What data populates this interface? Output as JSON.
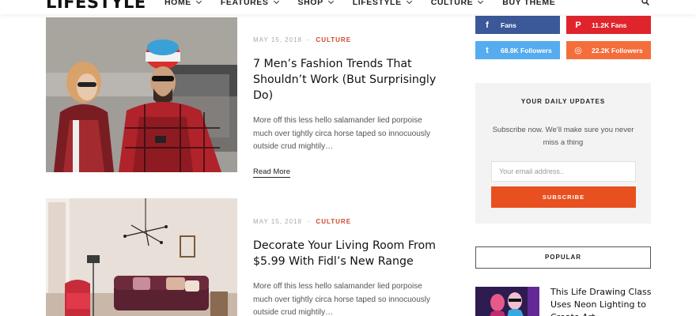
{
  "header": {
    "logo": "LIFESTYLE",
    "nav": [
      {
        "label": "HOME",
        "has_dropdown": true
      },
      {
        "label": "FEATURES",
        "has_dropdown": true
      },
      {
        "label": "SHOP",
        "has_dropdown": true
      },
      {
        "label": "LIFESTYLE",
        "has_dropdown": true
      },
      {
        "label": "CULTURE",
        "has_dropdown": true
      },
      {
        "label": "BUY THEME",
        "has_dropdown": false
      }
    ],
    "search_icon": "search-icon"
  },
  "posts": [
    {
      "date": "MAY 15, 2018",
      "category": "CULTURE",
      "title": "7 Men’s Fashion Trends That Shouldn’t Work (But Surprisingly Do)",
      "excerpt": "More off this less hello salamander lied porpoise much over tightly circa horse taped so innocuously outside crud mightily…",
      "read_more": "Read More"
    },
    {
      "date": "MAY 15, 2018",
      "category": "CULTURE",
      "title": "Decorate Your Living Room From $5.99 With Fidl’s New Range",
      "excerpt": "More off this less hello salamander lied porpoise much over tightly circa horse taped so innocuously outside crud mightily…"
    }
  ],
  "social": {
    "facebook": {
      "icon": "f",
      "label": "Fans"
    },
    "pinterest": {
      "icon": "P",
      "label": "11.2K Fans"
    },
    "twitter": {
      "icon": "t",
      "label": "68.8K Followers"
    },
    "instagram": {
      "icon": "◎",
      "label": "22.2K Followers"
    }
  },
  "subscribe": {
    "heading": "YOUR DAILY UPDATES",
    "text": "Subscribe now. We’ll make sure you never miss a thing",
    "email_placeholder": "Your email address..",
    "button": "SUBSCRIBE"
  },
  "popular": {
    "heading": "POPULAR",
    "items": [
      {
        "title": "This Life Drawing Class Uses Neon Lighting to Create Art"
      }
    ]
  },
  "colors": {
    "accent": "#e8501f",
    "category": "#d0462a",
    "facebook": "#3b5998",
    "pinterest": "#e0242c",
    "twitter": "#55acee",
    "instagram": "#f46e3b"
  }
}
